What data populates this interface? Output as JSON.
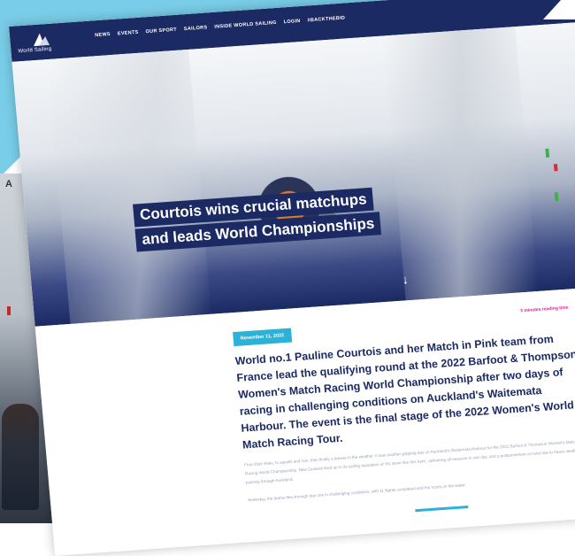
{
  "nav": {
    "logo_text": "World Sailing",
    "items": [
      "NEWS",
      "EVENTS",
      "OUR SPORT",
      "SAILORS",
      "INSIDE WORLD SAILING",
      "LOGIN",
      "#BACKTHEBID"
    ]
  },
  "hero": {
    "headline_line1": "Courtois wins crucial matchups",
    "headline_line2": "and leads World Championships",
    "scroll_icon": "↓"
  },
  "article": {
    "date": "November 11, 2022",
    "reading_time": "3 minutes reading time",
    "lead": "World no.1 Pauline Courtois and her Match in Pink team from France lead the qualifying round at the 2022 Barfoot & Thompson Women's Match Racing World Championship after two days of racing in challenging conditions on Auckland's Waitemata Harbour. The event is the final stage of the 2022 Women's World Match Racing Tour.",
    "body_1": "From blue skies, to squalls and rain, then finally a breeze in the weather. It was another gripping day on Auckland's Waitemata Harbour for the 2022 Barfoot & Thompson Women's Match Racing World Championship. New Zealand lived up to its sailing reputation of 'it's never like this here', delivering all seasons in one day, and a postponement on land due to heavy weather passing through Auckland.",
    "body_2": "Yesterday, the teams flew through day one in challenging conditions, with 11 flights completed and the hours on the water."
  },
  "background": {
    "corner_letter": "A"
  },
  "colors": {
    "navy": "#1b2a63",
    "teal": "#2cb2d6",
    "pink": "#e0189a",
    "sky": "#79cde8"
  }
}
